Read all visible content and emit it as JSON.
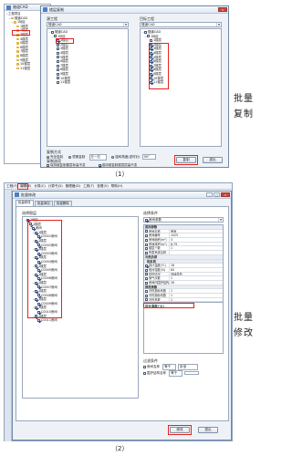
{
  "panel1": {
    "bg_window": {
      "title": "隧道CAD",
      "tree_root": "工程项目",
      "tree_project": "隧道CAD",
      "tree_node": "1地区",
      "floors": [
        "1楼层",
        "2楼层",
        "3楼层",
        "4楼层",
        "5楼层",
        "6楼层",
        "7楼层",
        "8楼层",
        "9楼层",
        "10楼层",
        "11楼层"
      ]
    },
    "dialog": {
      "title": "楼层复制",
      "source_label": "源工程",
      "target_label": "目标工程",
      "source_combo": "隧道CAD",
      "target_combo": "隧道CAD",
      "source_tree": {
        "root": "隧道CAD",
        "area": "1地区",
        "floors": [
          "1楼层",
          "2楼层",
          "3楼层",
          "4楼层",
          "5楼层",
          "6楼层",
          "7楼层",
          "8楼层",
          "9楼层",
          "10楼层",
          "11楼层"
        ],
        "checked": [
          true,
          false,
          false,
          false,
          false,
          false,
          false,
          false,
          false,
          false,
          false
        ]
      },
      "target_tree": {
        "root": "隧道CAD",
        "area": "1地区",
        "floors": [
          "1楼层",
          "2楼层",
          "3楼层",
          "4楼层",
          "5楼层",
          "6楼层",
          "7楼层",
          "8楼层",
          "9楼层",
          "10楼层",
          "11楼层"
        ],
        "checked": [
          false,
          true,
          true,
          true,
          true,
          true,
          true,
          true,
          true,
          true,
          true
        ]
      },
      "copy_mode_label": "复制方式",
      "mode_options": [
        "完全复制",
        "镜像复制",
        "旋转复制"
      ],
      "mirror_combo": "左一右",
      "rotate_label": "旋转角度(逆时针)",
      "rotate_value": "90°",
      "options_label": "复制选项",
      "opt1": "保持被复制楼层标高不变",
      "opt2": "保持被复制楼层层高不变",
      "copy_button": "复制",
      "exit_button": "退出"
    },
    "caption": "（1）",
    "side_text": [
      "批量",
      "复制"
    ]
  },
  "panel2": {
    "menu": [
      "工程(F)",
      "编辑(E)",
      "计算(C)",
      "计算书(S)",
      "管理器(D)",
      "工具(T)",
      "查看(V)",
      "帮助(H)"
    ],
    "dialog": {
      "title": "批量修改",
      "tabs": [
        "批量修改",
        "批量添加",
        "批量删除"
      ],
      "tree_label": "选择图层",
      "cond_label": "选择条件",
      "tree": {
        "root": "1地区",
        "floor": "1楼层",
        "sub": "房间",
        "rooms": [
          "C0001房间",
          "C0002房间",
          "C0003房间",
          "C0004房间",
          "C0005房间",
          "C0006房间",
          "C0007房间",
          "C0008房间",
          "C0009房间",
          "C0010房间",
          "C0011房间"
        ]
      },
      "prop_combo": "房间参数",
      "groups": {
        "g1": "房间参数",
        "g2": "冷热负荷",
        "g3": "热负荷",
        "g4": "换热系数"
      },
      "rows1": [
        {
          "k": "房间名称",
          "v": "房间"
        },
        {
          "k": "房间编号",
          "v": "1025"
        },
        {
          "k": "房间面积(m²)",
          "v": "3"
        },
        {
          "k": "房间体积(m³)",
          "v": "8.79"
        },
        {
          "k": "楼层个数",
          "v": "1"
        },
        {
          "k": "所属系统名称",
          "v": ""
        }
      ],
      "rows2": [
        {
          "k": "设计温度(℃)",
          "v": "18"
        },
        {
          "k": "相对湿度(%)",
          "v": "60"
        },
        {
          "k": "供热情况",
          "v": "连续供热"
        },
        {
          "k": "换气次数",
          "v": "1"
        },
        {
          "k": "房间内围护结构",
          "v": "26"
        }
      ],
      "rows3": [
        {
          "k": "冷热指标系数",
          "v": "1"
        },
        {
          "k": "冷热指标系数",
          "v": "1"
        },
        {
          "k": "冷热系数",
          "v": "1"
        }
      ],
      "desc": "设计温度(℃)",
      "filter_label": "过滤条件",
      "filter1": "房间名称",
      "filter1_op": "等于",
      "filter1_val": "卧室",
      "filter2": "围护结构名称",
      "filter2_op": "等于",
      "modify_button": "修改",
      "exit_button": "退出"
    },
    "caption": "（2）",
    "side_text": [
      "批量",
      "修改"
    ]
  },
  "colors": {
    "highlight": "#e3231c",
    "titlebar": "#dfe7f1",
    "window": "#eef2f7"
  }
}
